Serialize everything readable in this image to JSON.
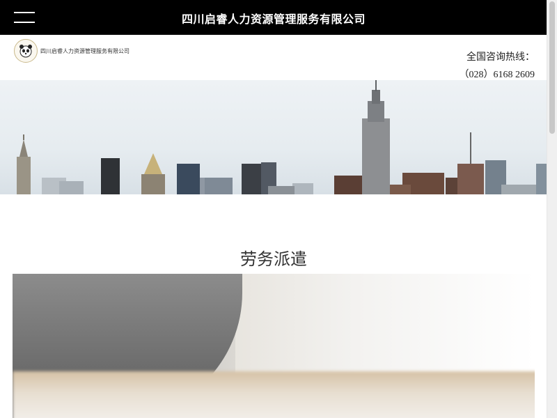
{
  "top_bar": {
    "site_title": "四川启睿人力资源管理服务有限公司",
    "background": "#000000"
  },
  "header": {
    "logo_text": "四川启睿人力资源管理服务有限公司",
    "hotline_label": "全国咨询热线：",
    "hotline_number": "（028）6168 2609"
  },
  "banner": {
    "image": "city-skyline"
  },
  "section": {
    "title": "劳务派遣"
  }
}
